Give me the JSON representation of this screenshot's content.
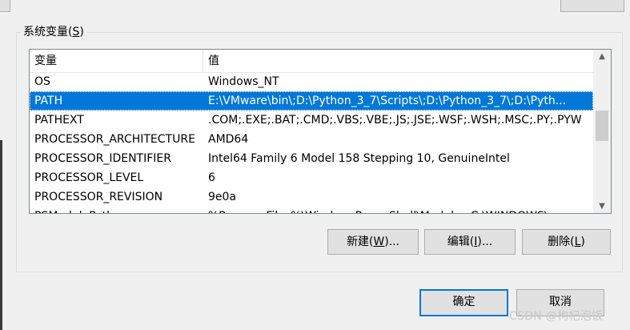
{
  "group": {
    "title_prefix": "系统变量(",
    "title_mnemonic": "S",
    "title_suffix": ")"
  },
  "table": {
    "columns": [
      "变量",
      "值"
    ],
    "rows": [
      {
        "name": "OS",
        "value": "Windows_NT",
        "selected": false
      },
      {
        "name": "PATH",
        "value": "E:\\VMware\\bin\\;D:\\Python_3_7\\Scripts\\;D:\\Python_3_7\\;D:\\Pyth...",
        "selected": true
      },
      {
        "name": "PATHEXT",
        "value": ".COM;.EXE;.BAT;.CMD;.VBS;.VBE;.JS;.JSE;.WSF;.WSH;.MSC;.PY;.PYW",
        "selected": false
      },
      {
        "name": "PROCESSOR_ARCHITECTURE",
        "value": "AMD64",
        "selected": false
      },
      {
        "name": "PROCESSOR_IDENTIFIER",
        "value": "Intel64 Family 6 Model 158 Stepping 10, GenuineIntel",
        "selected": false
      },
      {
        "name": "PROCESSOR_LEVEL",
        "value": "6",
        "selected": false
      },
      {
        "name": "PROCESSOR_REVISION",
        "value": "9e0a",
        "selected": false
      },
      {
        "name": "PSModulePath",
        "value": "%ProgramFiles%\\WindowsPowerShell\\Modules;C:\\WINDOWS\\...",
        "selected": false
      }
    ]
  },
  "buttons": {
    "new": {
      "prefix": "新建(",
      "mnemonic": "W",
      "suffix": ")..."
    },
    "edit": {
      "prefix": "编辑(",
      "mnemonic": "I",
      "suffix": ")..."
    },
    "delete": {
      "prefix": "删除(",
      "mnemonic": "L",
      "suffix": ")"
    },
    "ok": {
      "label": "确定"
    },
    "cancel": {
      "label": "取消"
    }
  },
  "watermark": "CSDN @枸杞泡饭",
  "colors": {
    "selection": "#0078d7",
    "default_button_border": "#0078d7"
  }
}
